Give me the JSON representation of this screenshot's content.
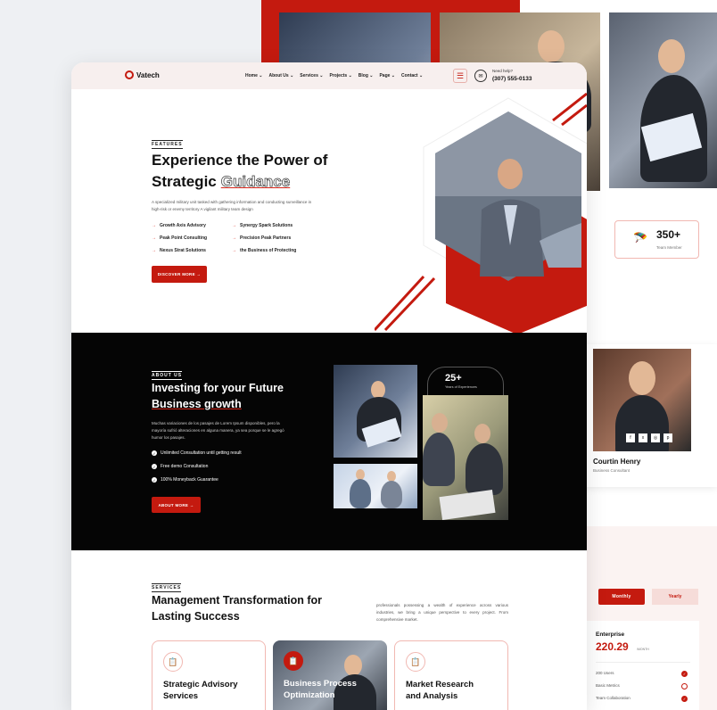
{
  "nav": {
    "brand": "Vatech",
    "items": [
      "Home",
      "About Us",
      "Services",
      "Projects",
      "Blog",
      "Page",
      "Contact"
    ],
    "help_label": "Need help?",
    "phone": "(307) 555-0133"
  },
  "hero": {
    "eyebrow": "FEATURES",
    "title_line1": "Experience the Power of",
    "title_line2_plain": "Strategic",
    "title_line2_outline": "Guidance",
    "desc1": "A specialized military unit tasked with gathering information and conducting surveillance in",
    "desc2": "high-risk or enemy territory A vigilant military team design",
    "features": [
      "Growth Axis Advisory",
      "Synergy Spark Solutions",
      "Peak Point Consulting",
      "Precision Peak Partners",
      "Nexus Strat Solutions",
      "the Business of Protecting"
    ],
    "button": "DISCOVER MORE"
  },
  "about": {
    "eyebrow": "ABOUT US",
    "title_line1": "Investing for your Future",
    "title_line2": "Business growth",
    "desc1": "Muchas variaciones de los pasajes de Lorem Ipsum disponibles, pero la",
    "desc2": "mayoría sufrió alteraciones en alguna manera, ya sea porque se le agregó",
    "desc3": "humor los pasajes.",
    "checks": [
      "Unlimited Consultation until getting result",
      "Free demo Consultation",
      "100% Moneyback Guarantee"
    ],
    "button": "ABOUT MORE",
    "exp_number": "25+",
    "exp_label": "Years of Experiences"
  },
  "services": {
    "eyebrow": "SERVICES",
    "title_line1": "Management Transformation for",
    "title_line2": "Lasting Success",
    "desc1": "professionals possessing a wealth of experience across",
    "desc2": "various industries, we bring a unique perspective to every",
    "desc3": "project. From comprehensive market.",
    "cards": [
      {
        "l1": "Strategic Advisory",
        "l2": "Services"
      },
      {
        "l1": "Business Process",
        "l2": "Optimization"
      },
      {
        "l1": "Market Research",
        "l2": "and Analysis"
      }
    ]
  },
  "back": {
    "stat_number": "350+",
    "stat_label": "Team Member",
    "team_name": "Courtin Henry",
    "team_role": "Business Consultant",
    "tab_monthly": "Monthly",
    "tab_yearly": "Yearly",
    "plan_name": "Enterprise",
    "plan_price": "220.29",
    "plan_period": "/MONTH",
    "plan_features": [
      "200 Users",
      "Basic Metrics",
      "Team Collaboration"
    ]
  },
  "colors": {
    "accent": "#c41a0f",
    "dark": "#050505"
  }
}
